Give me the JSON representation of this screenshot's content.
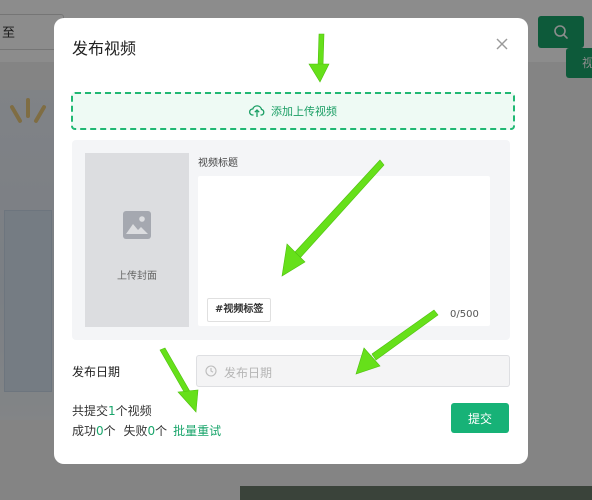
{
  "background": {
    "search_value": "至",
    "tab_label": "视"
  },
  "dialog": {
    "title": "发布视频",
    "upload_label": "添加上传视频",
    "cover_label": "上传封面",
    "video_title_label": "视频标题",
    "tag_label": "#视频标签",
    "char_count": "0/500",
    "date_label": "发布日期",
    "date_placeholder": "发布日期",
    "summary": {
      "total_prefix": "共提交",
      "total_count": "1",
      "total_suffix": "个视频",
      "success_prefix": "成功",
      "success_count": "0",
      "success_suffix": "个",
      "fail_prefix": "失败",
      "fail_count": "0",
      "fail_suffix": "个",
      "retry_label": "批量重试"
    },
    "submit_label": "提交"
  },
  "colors": {
    "accent": "#19a56b",
    "annotation_arrow": "#66e01a"
  },
  "icons": [
    "search-icon",
    "close-icon",
    "upload-cloud-icon",
    "image-icon",
    "clock-icon"
  ]
}
